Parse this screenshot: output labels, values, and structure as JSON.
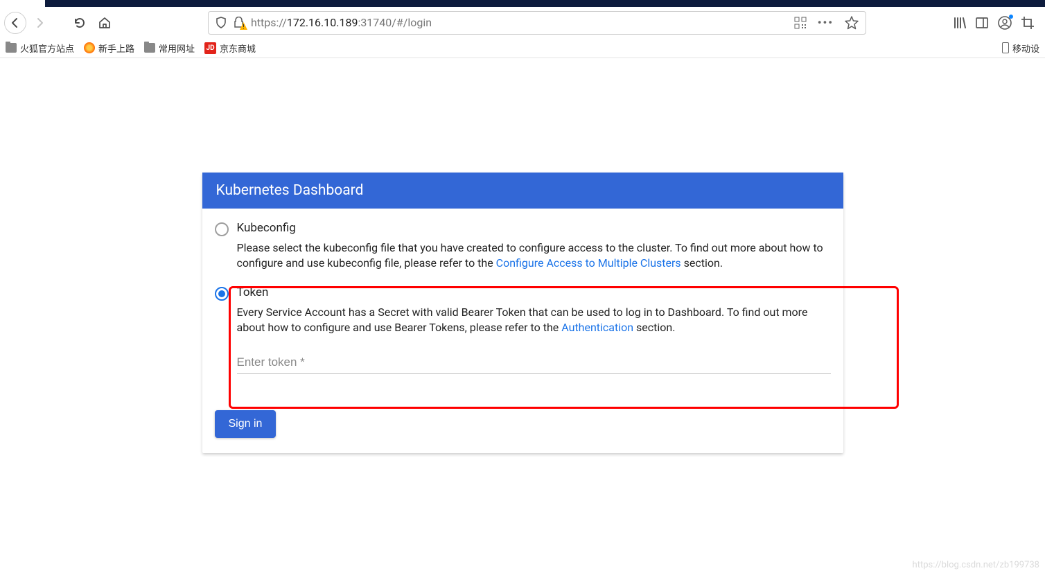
{
  "browser": {
    "url_prefix": "https://",
    "url_host": "172.16.10.189",
    "url_path": ":31740/#/login"
  },
  "bookmarks": {
    "b1": "火狐官方站点",
    "b2": "新手上路",
    "b3": "常用网址",
    "b4_icon": "JD",
    "b4": "京东商城",
    "mobile": "移动设"
  },
  "login": {
    "title": "Kubernetes Dashboard",
    "kubeconfig_label": "Kubeconfig",
    "kubeconfig_desc_1": "Please select the kubeconfig file that you have created to configure access to the cluster. To find out more about how to configure and use kubeconfig file, please refer to the ",
    "kubeconfig_link": "Configure Access to Multiple Clusters",
    "kubeconfig_desc_2": " section.",
    "token_label": "Token",
    "token_desc_1": "Every Service Account has a Secret with valid Bearer Token that can be used to log in to Dashboard. To find out more about how to configure and use Bearer Tokens, please refer to the ",
    "token_link": "Authentication",
    "token_desc_2": " section.",
    "token_placeholder": "Enter token *",
    "sign_in": "Sign in"
  },
  "watermark": "https://blog.csdn.net/zb199738"
}
